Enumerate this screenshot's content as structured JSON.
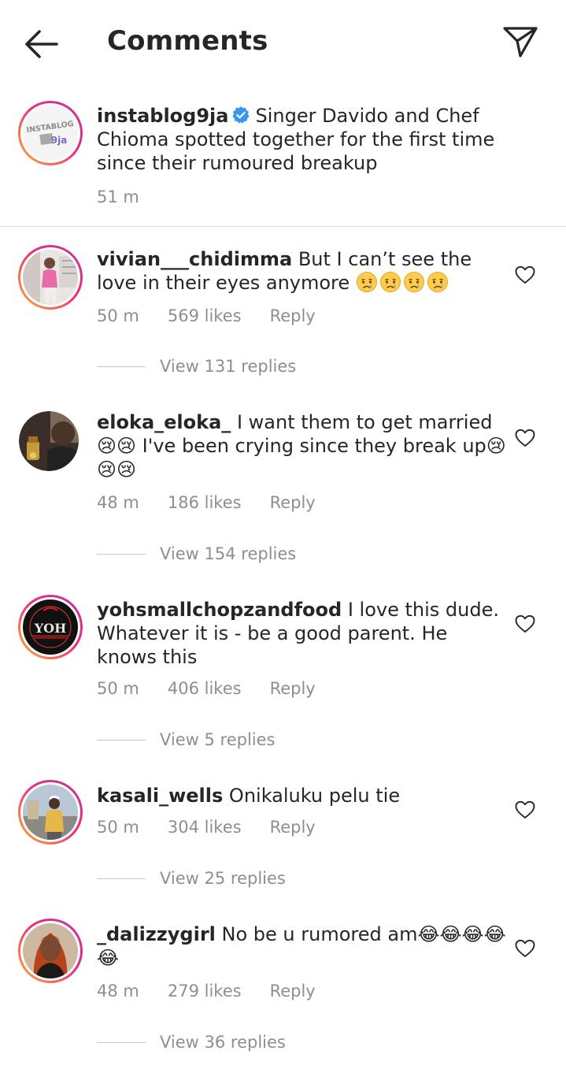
{
  "header": {
    "title": "Comments",
    "back_icon": "arrow-left-icon",
    "send_icon": "paper-plane-icon"
  },
  "caption": {
    "username": "instablog9ja",
    "text": "Singer Davido and Chef Chioma spotted together for the first time since their rumoured breakup",
    "time": "51 m",
    "avatar_label": "INSTABLOG 9ja"
  },
  "comments": [
    {
      "username": "vivian___chidimma",
      "text": "But I can’t see the love in their eyes anymore",
      "emoji": "😥😥😥😥",
      "time": "50 m",
      "likes": "569 likes",
      "reply": "Reply",
      "view_replies": "View 131 replies"
    },
    {
      "username": "eloka_eloka_",
      "text": "I want them to get married😢😢 I've been crying since they break up😢😢😢",
      "time": "48 m",
      "likes": "186 likes",
      "reply": "Reply",
      "view_replies": "View 154 replies"
    },
    {
      "username": "yohsmallchopzandfood",
      "text": "I love this dude. Whatever it is - be a good parent. He knows this",
      "time": "50 m",
      "likes": "406 likes",
      "reply": "Reply",
      "view_replies": "View 5 replies",
      "avatar_label": "YOH"
    },
    {
      "username": "kasali_wells",
      "text": "Onikaluku pelu tie",
      "time": "50 m",
      "likes": "304 likes",
      "reply": "Reply",
      "view_replies": "View 25 replies"
    },
    {
      "username": "_dalizzygirl",
      "text": "No be u rumored am😂😂😂😂😂",
      "time": "48 m",
      "likes": "279 likes",
      "reply": "Reply",
      "view_replies": "View 36 replies"
    }
  ],
  "colors": {
    "text": "#262626",
    "muted": "#8e8e8e",
    "verified": "#3897f0",
    "divider": "#dbdbdb"
  }
}
